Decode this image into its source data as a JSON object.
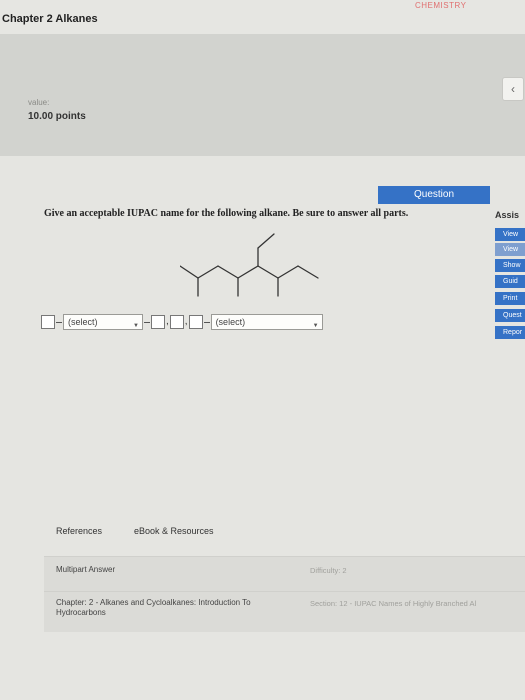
{
  "header": {
    "chapter_title": "Chapter 2 Alkanes",
    "brand": "CHEMISTRY"
  },
  "score": {
    "label": "value:",
    "points": "10.00 points"
  },
  "question": {
    "tab_label": "Question",
    "prompt": "Give an acceptable IUPAC name for the following alkane. Be sure to answer all parts."
  },
  "answer": {
    "select_1": "(select)",
    "select_2": "(select)",
    "comma_1": ",",
    "comma_2": ","
  },
  "sidebar": {
    "heading": "Assis",
    "buttons": [
      "View",
      "View",
      "Show",
      "Guid",
      "Print",
      "Quest",
      "Repor"
    ]
  },
  "references": {
    "tab_1": "References",
    "tab_2": "eBook & Resources"
  },
  "info": {
    "type": "Multipart Answer",
    "difficulty": "Difficulty: 2",
    "chapter": "Chapter: 2 - Alkanes and Cycloalkanes: Introduction To Hydrocarbons",
    "section": "Section: 12 - IUPAC Names of Highly Branched Al"
  }
}
